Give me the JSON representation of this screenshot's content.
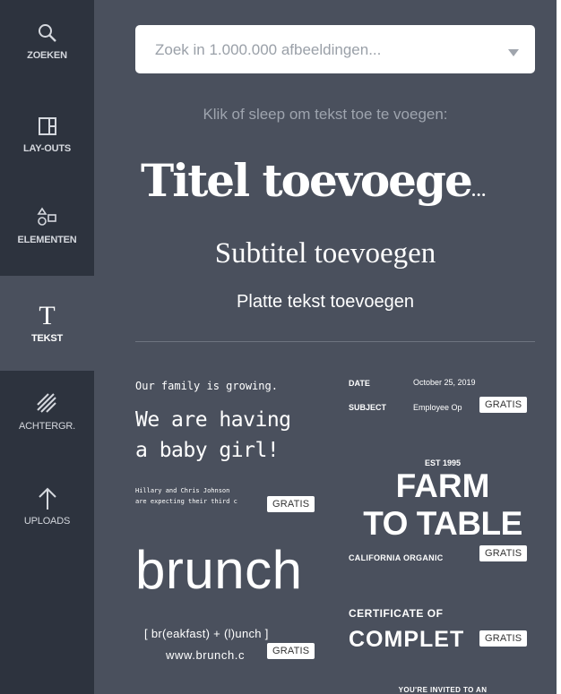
{
  "sidebar": {
    "items": [
      {
        "label": "ZOEKEN",
        "icon": "search-icon"
      },
      {
        "label": "LAY-OUTS",
        "icon": "layout-icon"
      },
      {
        "label": "ELEMENTEN",
        "icon": "shapes-icon"
      },
      {
        "label": "TEKST",
        "icon": "text-icon",
        "active": true
      },
      {
        "label": "ACHTERGR.",
        "icon": "background-pattern-icon"
      },
      {
        "label": "UPLOADS",
        "icon": "upload-arrow-icon"
      }
    ]
  },
  "search": {
    "placeholder": "Zoek in 1.000.000 afbeeldingen..."
  },
  "panel": {
    "hint": "Klik of sleep om tekst toe te voegen:",
    "title_text": "Titel toevoege",
    "title_ellipsis": "...",
    "subtitle_text": "Subtitel toevoegen",
    "body_text": "Platte tekst toevoegen"
  },
  "templates": {
    "baby": {
      "line1": "Our family is growing.",
      "line2": "We are having",
      "line3": "a baby girl!",
      "line4": "Hillary and Chris Johnson",
      "line5": "are expecting their third c",
      "badge": "GRATIS"
    },
    "memo": {
      "date_label": "DATE",
      "date_value": "October 25, 2019",
      "subject_label": "SUBJECT",
      "subject_value": "Employee Op",
      "badge": "GRATIS"
    },
    "farm": {
      "est": "EST 1995",
      "line1": "FARM",
      "line2": "TO TABLE",
      "tagline": "CALIFORNIA ORGANIC",
      "badge": "GRATIS"
    },
    "brunch": {
      "word": "brunch",
      "line1": "[ br(eakfast) + (l)unch ]",
      "line2": "www.brunch.c",
      "badge": "GRATIS"
    },
    "certificate": {
      "line1": "CERTIFICATE OF",
      "line2": "COMPLET",
      "badge": "GRATIS"
    },
    "invite": {
      "line1": "YOU'RE INVITED TO AN"
    }
  },
  "colors": {
    "sidebar_bg": "#2d333e",
    "panel_bg": "#4a505d",
    "active_item_bg": "#4a505d",
    "badge_bg": "#ffffff"
  }
}
